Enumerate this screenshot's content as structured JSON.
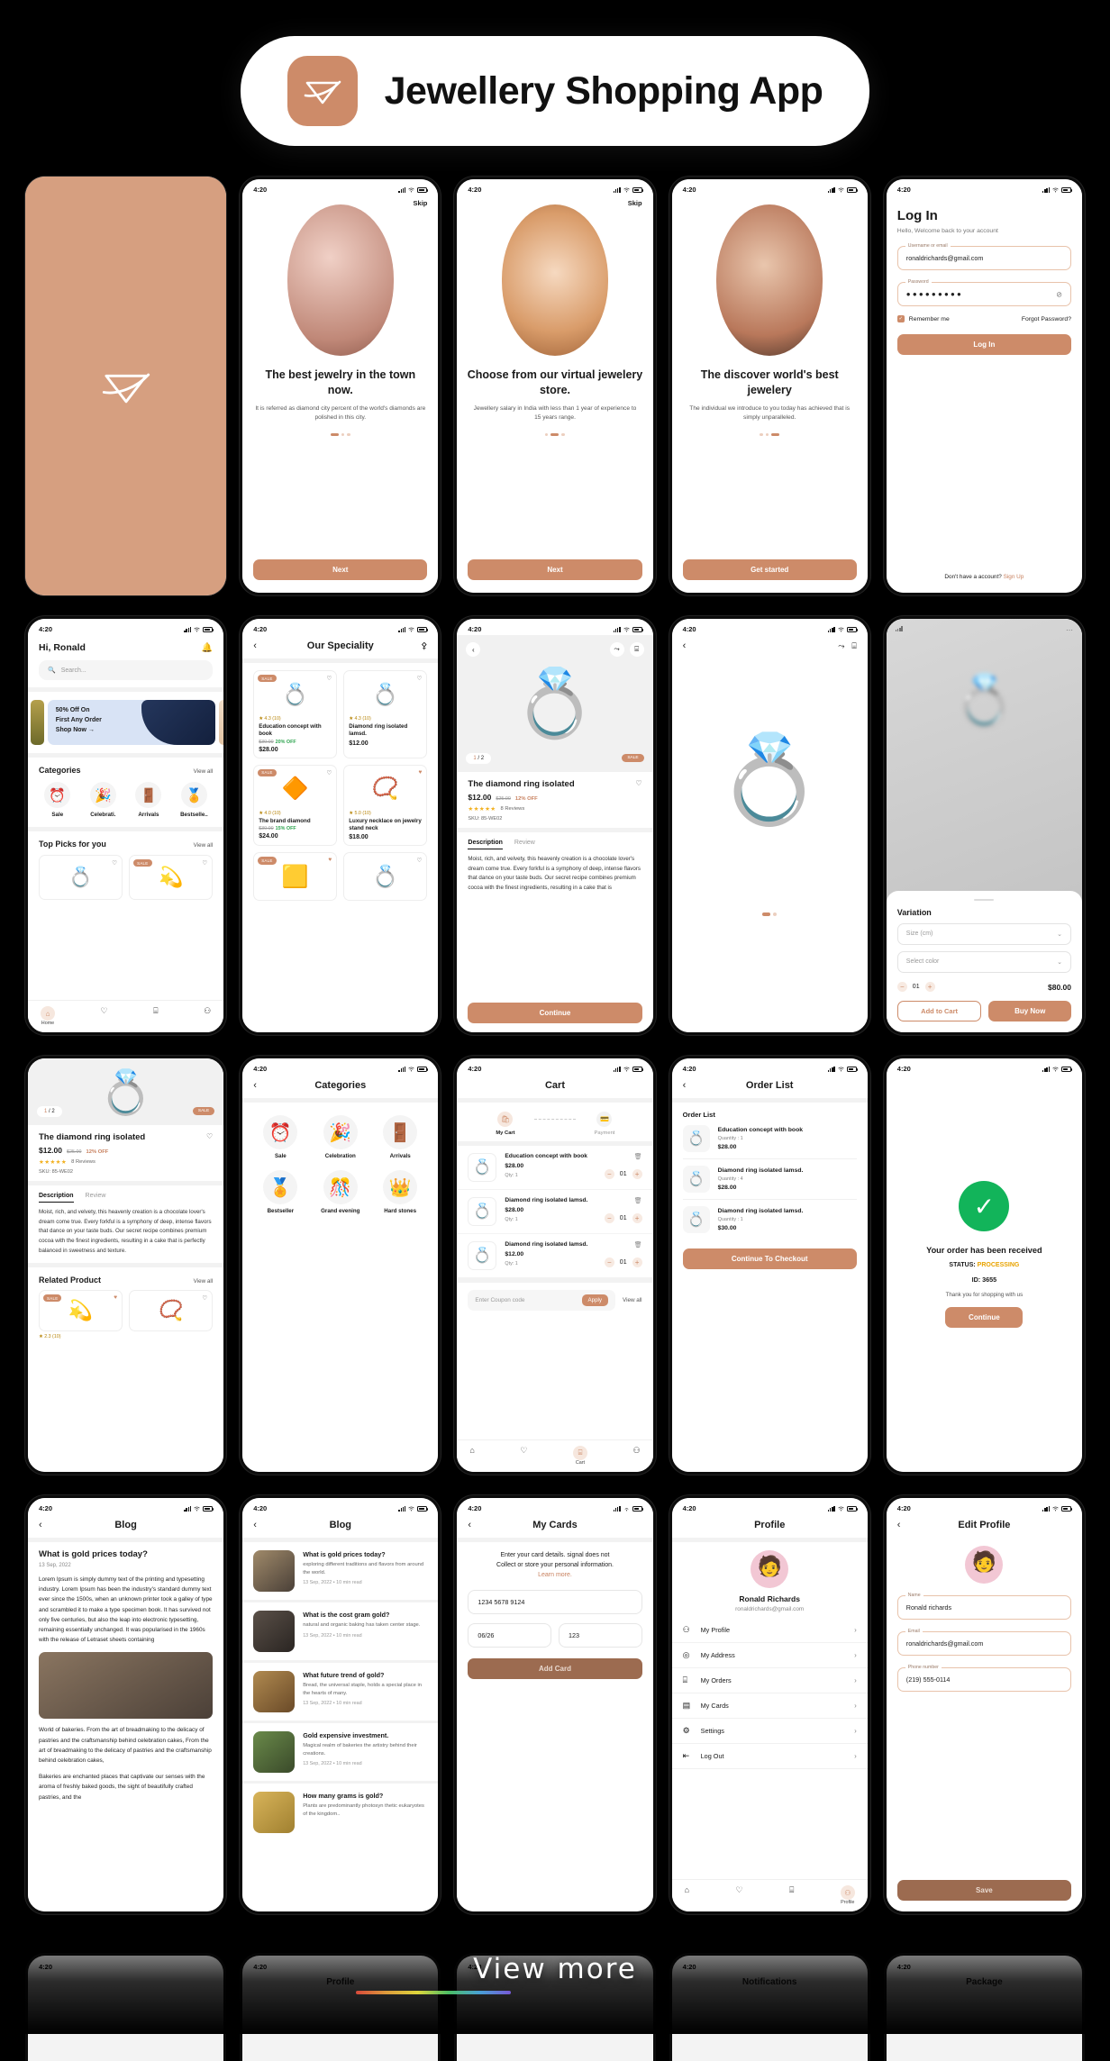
{
  "header": {
    "title": "Jewellery Shopping App",
    "logo_icon": "diamond-gem-icon",
    "accent": "#cd8b69"
  },
  "status_bar": {
    "time": "4:20"
  },
  "onboarding": [
    {
      "skip": "Skip",
      "title": "The best jewelry in the town now.",
      "subtitle": "It is referred as diamond city percent of the world's diamonds are polished in this city.",
      "button": "Next",
      "active_dot": 0
    },
    {
      "skip": "Skip",
      "title": "Choose from our virtual jewelery store.",
      "subtitle": "Jewellery salary in India with less than 1 year of experience to 15 years range.",
      "button": "Next",
      "active_dot": 1
    },
    {
      "skip": "",
      "title": "The discover world's best jewelery",
      "subtitle": "The individual we introduce to you today has achieved that is simply unparalleled.",
      "button": "Get started",
      "active_dot": 2
    }
  ],
  "login": {
    "title": "Log In",
    "subtitle": "Hello, Welcome back to your account",
    "username_label": "Username or email",
    "username_value": "ronaldrichards@gmail.com",
    "password_label": "Password",
    "password_value": "●●●●●●●●●",
    "eye_icon": "eye-off-icon",
    "remember_label": "Remember me",
    "forgot_label": "Forgot Password?",
    "button": "Log In",
    "footer_text": "Don't have a account?",
    "footer_link": "Sign Up"
  },
  "home": {
    "greeting": "Hi, Ronald",
    "bell_icon": "bell-icon",
    "search_placeholder": "Search...",
    "banner": {
      "line1": "50% Off On",
      "line2": "First Any Order",
      "cta": "Shop Now  →"
    },
    "categories_title": "Categories",
    "view_all": "View all",
    "categories": [
      {
        "label": "Sale",
        "icon": "⏰"
      },
      {
        "label": "Celebrati.",
        "icon": "🎉"
      },
      {
        "label": "Arrivals",
        "icon": "🚪"
      },
      {
        "label": "Bestselle..",
        "icon": "🏅"
      }
    ],
    "top_picks_title": "Top Picks for you",
    "picks": [
      {
        "icon": "💍",
        "sale": false
      },
      {
        "icon": "💫",
        "sale": true,
        "sale_label": "SALE"
      }
    ],
    "tabs": [
      {
        "label": "Home",
        "icon": "⌂",
        "active": true
      },
      {
        "label": "",
        "icon": "♡",
        "active": false
      },
      {
        "label": "",
        "icon": "🛍",
        "active": false
      },
      {
        "label": "",
        "icon": "👤",
        "active": false
      }
    ]
  },
  "speciality": {
    "title": "Our Speciality",
    "filter_icon": "filter-icon",
    "products": [
      {
        "sale": "SALE",
        "fav": false,
        "rating": "★ 4.3 (10)",
        "name": "Education concept with book",
        "old": "$30.00",
        "off": "20% OFF",
        "price": "$28.00",
        "icon": "💍"
      },
      {
        "sale": "",
        "fav": false,
        "rating": "★ 4.3 (10)",
        "name": "Diamond ring isolated lamsd.",
        "old": "",
        "off": "",
        "price": "$12.00",
        "icon": "💍"
      },
      {
        "sale": "SALE",
        "fav": false,
        "rating": "★ 4.0 (10)",
        "name": "The brand diamond",
        "old": "$30.00",
        "off": "15% OFF",
        "price": "$24.00",
        "icon": "🔶"
      },
      {
        "sale": "",
        "fav": true,
        "rating": "★ 5.0 (10)",
        "name": "Luxury necklace on jewelry stand neck",
        "old": "",
        "off": "",
        "price": "$18.00",
        "icon": "📿"
      },
      {
        "sale": "SALE",
        "fav": true,
        "rating": "",
        "name": "",
        "old": "",
        "off": "",
        "price": "",
        "icon": "🟨"
      },
      {
        "sale": "",
        "fav": false,
        "rating": "",
        "name": "",
        "old": "",
        "off": "",
        "price": "",
        "icon": "💍"
      }
    ]
  },
  "product": {
    "pager": "1 / 2",
    "sale_badge": "SALE",
    "share_icon": "share-icon",
    "bag_icon": "bag-icon",
    "title": "The diamond ring isolated",
    "price": "$12.00",
    "old_price": "$25.00",
    "discount": "12% OFF",
    "stars": "★★★★★",
    "reviews": "8 Reviews",
    "sku": "SKU: 85-WE02",
    "tab_description": "Description",
    "tab_review": "Review",
    "description": "Moist, rich, and velvety, this heavenly creation is a chocolate lover's dream come true. Every forkful is a symphony of deep, intense flavors that dance on your taste buds. Our secret recipe combines premium cocoa with the finest ingredients, resulting in a cake that is",
    "description_full": "Moist, rich, and velvety, this heavenly creation is a chocolate lover's dream come true. Every forkful is a symphony of deep, intense flavors that dance on your taste buds. Our secret recipe combines premium cocoa with the finest ingredients, resulting in a cake that is perfectly balanced in sweetness and texture.",
    "button": "Continue",
    "related_title": "Related Product",
    "related_view_all": "View all",
    "related": [
      {
        "sale": "SALE",
        "fav": true,
        "rating": "★ 2.3 (10)",
        "icon": "💫"
      },
      {
        "sale": "",
        "fav": false,
        "rating": "",
        "icon": "📿"
      }
    ]
  },
  "variation": {
    "title": "Variation",
    "size_placeholder": "Size (cm)",
    "color_placeholder": "Select color",
    "qty": "01",
    "minus": "−",
    "plus": "+",
    "total": "$80.00",
    "add_to_cart": "Add to Cart",
    "buy_now": "Buy Now"
  },
  "categories_page": {
    "title": "Categories",
    "items": [
      {
        "label": "Sale",
        "icon": "⏰"
      },
      {
        "label": "Celebration",
        "icon": "🎉"
      },
      {
        "label": "Arrivals",
        "icon": "🚪"
      },
      {
        "label": "Bestseller",
        "icon": "🏅"
      },
      {
        "label": "Grand evening",
        "icon": "🎊"
      },
      {
        "label": "Hard stones",
        "icon": "👑"
      }
    ]
  },
  "cart": {
    "title": "Cart",
    "steps": [
      {
        "label": "My Cart",
        "icon": "🛍",
        "active": true
      },
      {
        "label": "Payment",
        "icon": "💳",
        "active": false
      }
    ],
    "items": [
      {
        "name": "Education concept with book",
        "price": "$28.00",
        "qty_label": "Qty: 1",
        "qty": "01",
        "icon": "💍"
      },
      {
        "name": "Diamond ring isolated lamsd.",
        "price": "$28.00",
        "qty_label": "Qty: 1",
        "qty": "01",
        "icon": "💍"
      },
      {
        "name": "Diamond ring isolated lamsd.",
        "price": "$12.00",
        "qty_label": "Qty: 1",
        "qty": "01",
        "icon": "💍"
      }
    ],
    "coupon_placeholder": "Enter Coupon code",
    "apply": "Apply",
    "view_all": "View all",
    "trash_icon": "trash-icon",
    "tab_active_label": "Cart"
  },
  "order_list": {
    "title": "Order List",
    "section_label": "Order List",
    "items": [
      {
        "name": "Education concept with book",
        "qty": "Quantity : 1",
        "price": "$28.00",
        "icon": "💍"
      },
      {
        "name": "Diamond ring isolated lamsd.",
        "qty": "Quantity : 4",
        "price": "$28.00",
        "icon": "💍"
      },
      {
        "name": "Diamond ring isolated lamsd.",
        "qty": "Quantity : 1",
        "price": "$30.00",
        "icon": "💍"
      }
    ],
    "button": "Continue To Checkout"
  },
  "success": {
    "check_icon": "check-circle-icon",
    "check_color": "#12b45a",
    "title": "Your order has been received",
    "status_label": "STATUS:",
    "status_value": "PROCESSING",
    "status_color": "#e8a300",
    "id": "ID: 3655",
    "thanks": "Thank you for shopping with us",
    "button": "Continue"
  },
  "blog_detail": {
    "title": "Blog",
    "heading": "What is gold prices today?",
    "date": "13 Sep, 2022",
    "paragraph1": "Lorem Ipsum is simply dummy text of the printing and typesetting industry. Lorem Ipsum has been the industry's standard dummy text ever since the 1500s, when an unknown printer took a galley of type and scrambled it to make a type specimen book. It has survived not only five centuries, but also the leap into electronic typesetting, remaining essentially unchanged. It was popularised in the 1960s with the release of Letraset sheets containing",
    "paragraph2": "World of bakeries. From the art of breadmaking to the delicacy of pastries and the craftsmanship behind celebration cakes, From the art of breadmaking to the delicacy of pastries and the craftsmanship behind celebration cakes,",
    "paragraph3": "Bakeries are enchanted places that captivate our senses with the aroma of freshly baked goods, the sight of beautifully crafted pastries, and the"
  },
  "blog_list": {
    "title": "Blog",
    "items": [
      {
        "title": "What is gold prices today?",
        "excerpt": "exploring different traditions and flavors from around the world.",
        "meta": "13 Sep, 2022  •  10 min read",
        "thumb": "#7d6a55"
      },
      {
        "title": "What is the cost gram gold?",
        "excerpt": "natural and organic baking has taken center stage.",
        "meta": "13 Sep, 2022  •  10 min read",
        "thumb": "#3a3430"
      },
      {
        "title": "What future trend of gold?",
        "excerpt": "Bread, the universal staple, holds a special place in the hearts of many.",
        "meta": "13 Sep, 2022  •  10 min read",
        "thumb": "#8a6236"
      },
      {
        "title": "Gold expensive investment.",
        "excerpt": "Magical realm of bakeries the artistry behind their creations.",
        "meta": "13 Sep, 2022  •  10 min read",
        "thumb": "#4a5a3a"
      },
      {
        "title": "How many grams is gold?",
        "excerpt": "Plants are predominantly photosyn thetic eukaryotes of the kingdom..",
        "meta": "",
        "thumb": "#c8a04a"
      }
    ]
  },
  "my_cards": {
    "title": "My Cards",
    "note_line1": "Enter your card details. signal does not",
    "note_line2": "Collect or store your personal information.",
    "note_link": "Learn more.",
    "card_number": "1234 5678 9124",
    "expiry": "06/26",
    "cvv": "123",
    "button": "Add Card"
  },
  "profile": {
    "title": "Profile",
    "name": "Ronald Richards",
    "email": "ronaldrichards@gmail.com",
    "menu": [
      {
        "label": "My Profile",
        "icon": "👤"
      },
      {
        "label": "My Address",
        "icon": "◎"
      },
      {
        "label": "My Orders",
        "icon": "🛍"
      },
      {
        "label": "My Cards",
        "icon": "▭"
      },
      {
        "label": "Settings",
        "icon": "⚙"
      },
      {
        "label": "Log Out",
        "icon": "⇤"
      }
    ],
    "tab_active_label": "Profile"
  },
  "edit_profile": {
    "title": "Edit Profile",
    "name_label": "Name",
    "name_value": "Ronald richards",
    "email_label": "Email",
    "email_value": "ronaldrichards@gmail.com",
    "phone_label": "Phone number",
    "phone_value": "(219) 555-0114",
    "button": "Save"
  },
  "footer": {
    "view_more": "View more"
  },
  "bottom_row": [
    {
      "title": ""
    },
    {
      "title": "Profile"
    },
    {
      "title": ""
    },
    {
      "title": "Notifications"
    },
    {
      "title": "Package"
    }
  ]
}
